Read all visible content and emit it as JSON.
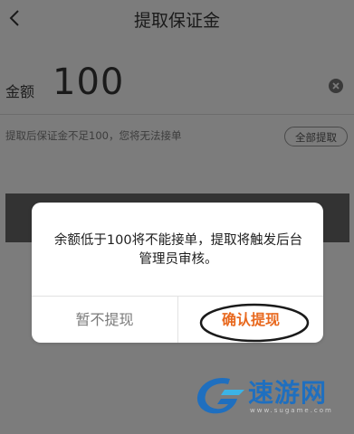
{
  "header": {
    "title": "提取保证金",
    "back_icon": "chevron-left-icon"
  },
  "amount": {
    "label": "金额",
    "value": "100",
    "clear_icon": "clear-circle-icon"
  },
  "hint": {
    "text": "提取后保证金不足100，您将无法接单",
    "withdraw_all_label": "全部提取"
  },
  "dialog": {
    "message": "余额低于100将不能接单，提取将触发后台管理员审核。",
    "cancel_label": "暂不提现",
    "confirm_label": "确认提现"
  },
  "colors": {
    "overlay": "#7c7c7c",
    "confirm_text": "#e8691f",
    "cancel_text": "#7a7a7a",
    "watermark": "#1f6fbf"
  },
  "watermark": {
    "text": "速游网",
    "url": "www.sugame.com"
  }
}
